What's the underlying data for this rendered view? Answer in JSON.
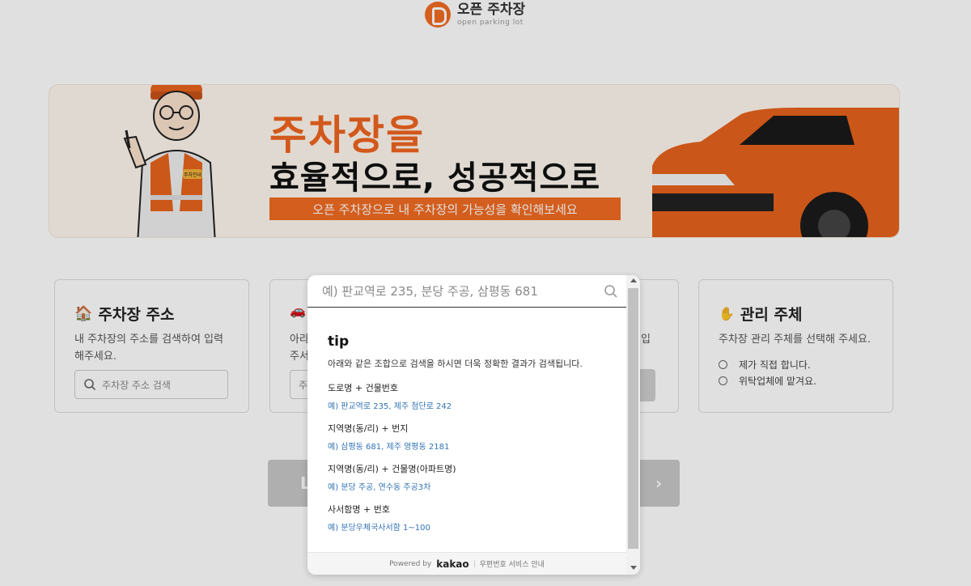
{
  "header": {
    "logo_title": "오픈 주차장",
    "logo_subtitle": "open parking lot"
  },
  "banner": {
    "headline": "주차장을",
    "subline": "효율적으로, 성공적으로",
    "strip_text": "오픈 주차장으로 내 주차장의 가능성을 확인해보세요",
    "mascot_badge": "주차안내"
  },
  "cards": {
    "address": {
      "title": "주차장 주소",
      "desc": "내 주차장의 주소를 검색하여 입력해주세요.",
      "search_placeholder": "주차장 주소 검색"
    },
    "second": {
      "desc_line1": "아라",
      "desc_line2": "주서",
      "input_fragment": "주"
    },
    "third": {
      "desc_fragment": "입"
    },
    "management": {
      "title": "관리 주체",
      "desc": "주차장 관리 주체를 선택해 주세요.",
      "option1": "제가 직접 합니다.",
      "option2": "위탁업체에 맡겨요."
    }
  },
  "nav": {
    "prev_fragment": "L",
    "next_arrow": "›"
  },
  "popup": {
    "search_placeholder": "예) 판교역로 235, 분당 주공, 삼평동 681",
    "tip_title": "tip",
    "tip_desc": "아래와 같은 조합으로 검색을 하시면 더욱 정확한 결과가 검색됩니다.",
    "groups": [
      {
        "label": "도로명 + 건물번호",
        "example": "예) 판교역로 235,  제주 첨단로 242"
      },
      {
        "label": "지역명(동/리) + 번지",
        "example": "예) 삼평동 681,  제주 영평동 2181"
      },
      {
        "label": "지역명(동/리) + 건물명(아파트명)",
        "example": "예) 분당 주공,  연수동 주공3차"
      },
      {
        "label": "사서함명 + 번호",
        "example": "예) 분당우체국사서함 1~100"
      }
    ],
    "footer_powered": "Powered by",
    "footer_brand": "kakao",
    "footer_link": "우편번호 서비스 안내"
  },
  "colors": {
    "brand_orange": "#f26b21",
    "link_blue": "#3374b6"
  }
}
